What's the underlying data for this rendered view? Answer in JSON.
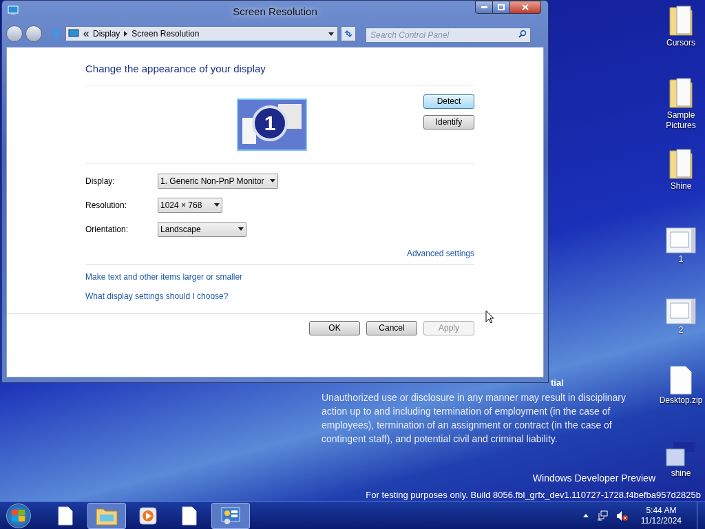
{
  "window": {
    "title": "Screen Resolution"
  },
  "address": {
    "crumbs": [
      "Display",
      "Screen Resolution"
    ],
    "search_placeholder": "Search Control Panel"
  },
  "content": {
    "heading": "Change the appearance of your display",
    "monitor_number": "1",
    "side_buttons": [
      {
        "label": "Detect",
        "focused": true
      },
      {
        "label": "Identify",
        "focused": false
      }
    ],
    "fields": [
      {
        "label": "Display:",
        "value": "1. Generic Non-PnP Monitor"
      },
      {
        "label": "Resolution:",
        "value": "1024 × 768"
      },
      {
        "label": "Orientation:",
        "value": "Landscape"
      }
    ],
    "advanced_link": "Advanced settings",
    "links": [
      "Make text and other items larger or smaller",
      "What display settings should I choose?"
    ],
    "buttons": [
      {
        "label": "OK",
        "disabled": false
      },
      {
        "label": "Cancel",
        "disabled": false
      },
      {
        "label": "Apply",
        "disabled": true
      }
    ]
  },
  "desktop_icons": [
    {
      "label": "Cursors",
      "kind": "folder"
    },
    {
      "label": "Sample Pictures",
      "kind": "folder"
    },
    {
      "label": "Shine",
      "kind": "folder"
    },
    {
      "label": "1",
      "kind": "archive"
    },
    {
      "label": "2",
      "kind": "archive"
    },
    {
      "label": "Desktop.zip",
      "kind": "file"
    },
    {
      "label": "shine",
      "kind": "shortcut"
    }
  ],
  "notice": {
    "heading": "tial",
    "text": "Unauthorized use or disclosure in any manner may result in disciplinary action up to and including termination of employment (in the case of employees), termination of an assignment or contract (in the case of contingent staff), and potential civil and criminal liability."
  },
  "watermark": [
    "Windows Developer Preview",
    "For testing purposes only. Build 8056.fbl_grfx_dev1.110727-1728.f4befba957d2825b"
  ],
  "taskbar": {
    "items": [
      {
        "kind": "file",
        "selected": false
      },
      {
        "kind": "explorer",
        "selected": true
      },
      {
        "kind": "media",
        "selected": false
      },
      {
        "kind": "file",
        "selected": false
      },
      {
        "kind": "control",
        "selected": true
      }
    ],
    "time": "5:44 AM",
    "date": "11/12/2024"
  }
}
